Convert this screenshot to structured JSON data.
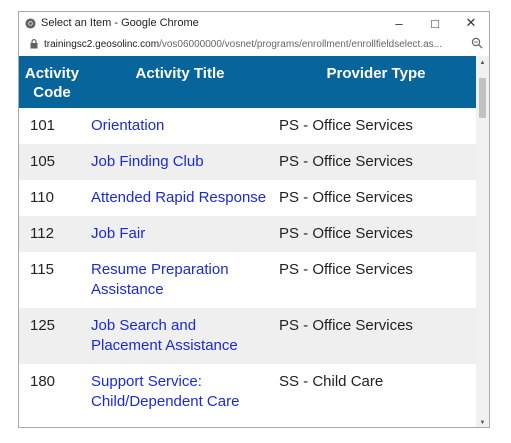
{
  "window": {
    "title": "Select an Item - Google Chrome",
    "url_host": "trainingsc2.geosolinc.com",
    "url_path": "/vos06000000/vosnet/programs/enrollment/enrollfieldselect.as..."
  },
  "table": {
    "headers": {
      "code": "Activity Code",
      "title": "Activity Title",
      "provider": "Provider Type"
    },
    "rows": [
      {
        "code": "101",
        "title": "Orientation",
        "provider": "PS - Office Services"
      },
      {
        "code": "105",
        "title": "Job Finding Club",
        "provider": "PS - Office Services"
      },
      {
        "code": "110",
        "title": "Attended Rapid Response",
        "provider": "PS - Office Services"
      },
      {
        "code": "112",
        "title": "Job Fair",
        "provider": "PS - Office Services"
      },
      {
        "code": "115",
        "title": "Resume Preparation Assistance",
        "provider": "PS - Office Services"
      },
      {
        "code": "125",
        "title": "Job Search and Placement Assistance",
        "provider": "PS - Office Services"
      },
      {
        "code": "180",
        "title": "Support Service: Child/Dependent Care",
        "provider": "SS - Child Care"
      }
    ]
  },
  "colors": {
    "header_bg": "#07659c",
    "link": "#1a2bd6",
    "row_alt": "#efefef"
  },
  "icons": {
    "browser": "chrome-logo-icon",
    "lock": "lock-icon",
    "zoom": "zoom-icon",
    "minimize": "minimize-icon",
    "maximize": "maximize-icon",
    "close": "close-icon"
  }
}
